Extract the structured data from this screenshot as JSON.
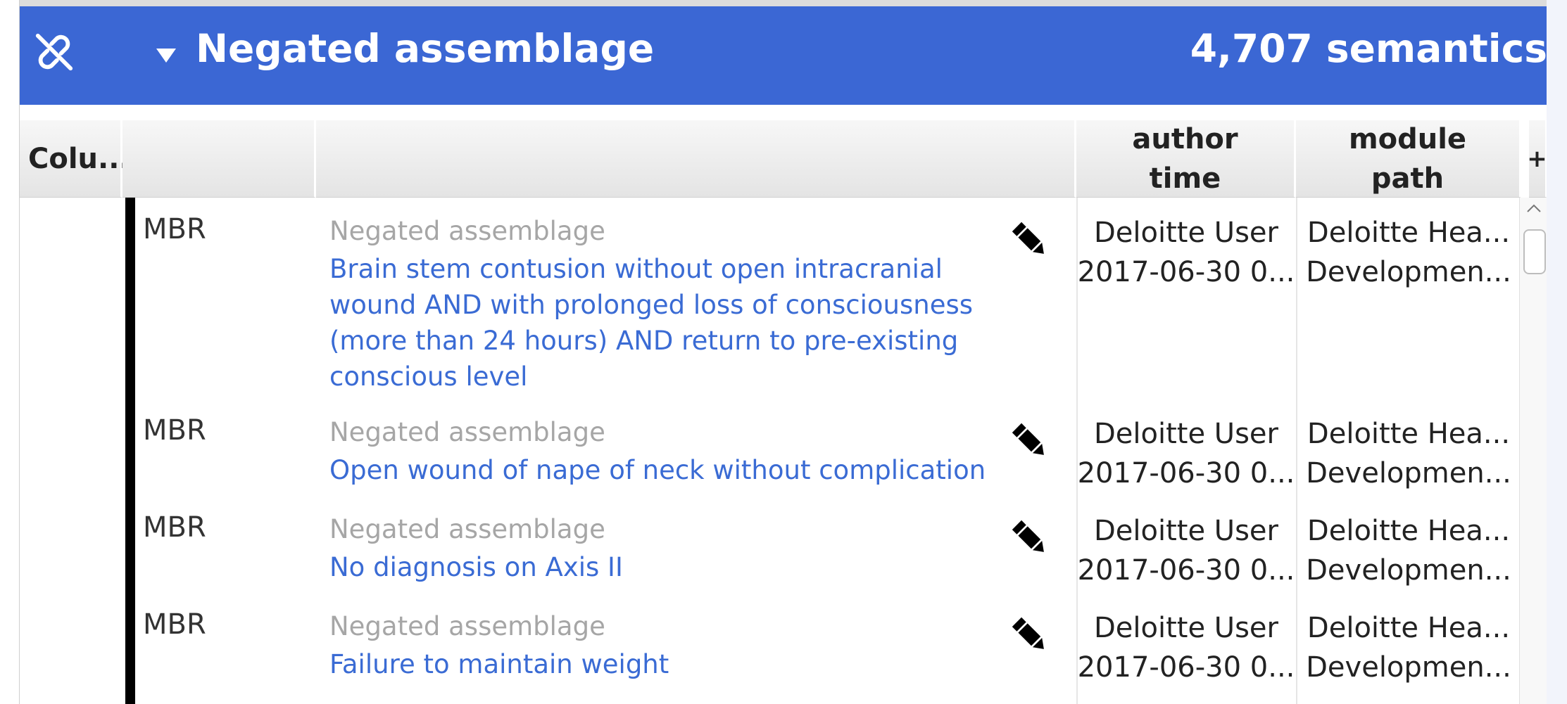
{
  "header": {
    "unlink_icon": "link-off-icon",
    "expand_icon": "caret-down-icon",
    "title": "Negated assemblage",
    "count": "4,707 semantics",
    "background": "#3b67d4"
  },
  "columns": {
    "first": "Colu...",
    "second": "",
    "third": "",
    "author": [
      "author",
      "time"
    ],
    "module": [
      "module",
      "path"
    ],
    "add": "+"
  },
  "rows": [
    {
      "type": "MBR",
      "kind": "Negated assemblage",
      "name": "Brain stem contusion without open intracranial wound AND with prolonged loss of consciousness (more than 24 hours) AND return to pre-existing conscious level",
      "edit_icon": "pencil-icon",
      "author": "Deloitte User",
      "time": "2017-06-30 0...",
      "module": "Deloitte Hea...",
      "path": "Developmen..."
    },
    {
      "type": "MBR",
      "kind": "Negated assemblage",
      "name": "Open wound of nape of neck without complication",
      "edit_icon": "pencil-icon",
      "author": "Deloitte User",
      "time": "2017-06-30 0...",
      "module": "Deloitte Hea...",
      "path": "Developmen..."
    },
    {
      "type": "MBR",
      "kind": "Negated assemblage",
      "name": "No diagnosis on Axis II",
      "edit_icon": "pencil-icon",
      "author": "Deloitte User",
      "time": "2017-06-30 0...",
      "module": "Deloitte Hea...",
      "path": "Developmen..."
    },
    {
      "type": "MBR",
      "kind": "Negated assemblage",
      "name": "Failure to maintain weight",
      "edit_icon": "pencil-icon",
      "author": "Deloitte User",
      "time": "2017-06-30 0...",
      "module": "Deloitte Hea...",
      "path": "Developmen..."
    }
  ],
  "scrollbar": {
    "up_icon": "scroll-up-icon"
  }
}
